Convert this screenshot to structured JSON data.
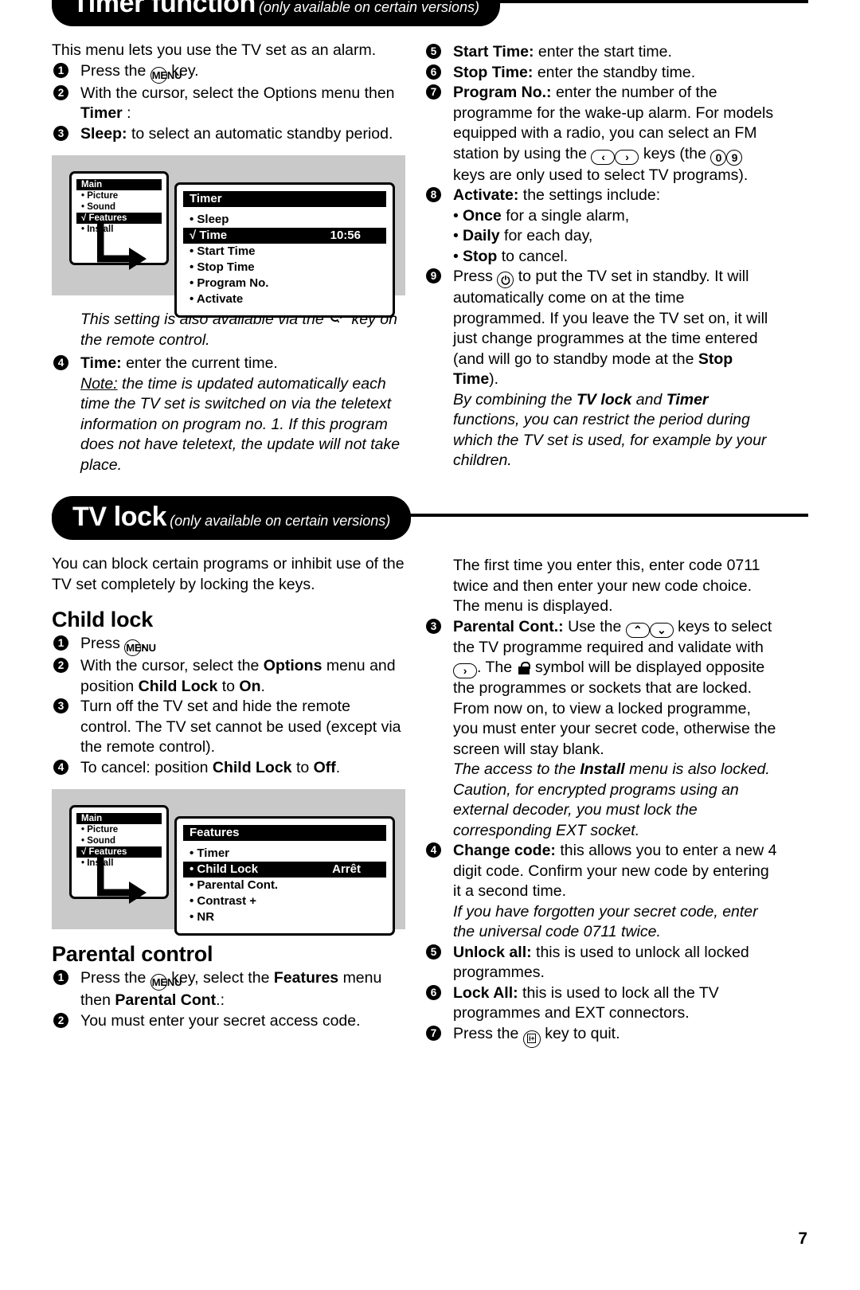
{
  "page": {
    "number": "7"
  },
  "sections": {
    "timer": {
      "banner_title": "Timer function",
      "banner_sub": "(only available on certain versions)",
      "intro": "This menu lets you use the TV set as an alarm.",
      "step1_pre": "Press the",
      "step1_post": "key.",
      "step2_line1": "With the cursor, select the Options menu then",
      "step2_line2_bold": "Timer",
      "step2_line2_post": ":",
      "step3_bold": "Sleep:",
      "step3_rest": "to select an automatic standby period.",
      "note_pre": "This setting is also available via the",
      "note_post": "key on the remote control.",
      "step4_bold": "Time:",
      "step4_rest": "enter the current time.",
      "step4_note_label": "Note:",
      "step4_note": "the time is updated automatically each time the TV set is switched on via the teletext information on program no. 1. If this program does not have teletext, the update will not take place.",
      "step5_bold": "Start Time:",
      "step5_rest": "enter the start time.",
      "step6_bold": "Stop Time:",
      "step6_rest": "enter the standby time.",
      "step7_bold": "Program No.:",
      "step7_rest_a": "enter the number of the programme for the wake-up alarm. For models equipped with a radio, you can select an FM station by using the",
      "step7_rest_b": "keys (the",
      "step7_rest_c": "keys are only used to select TV programs).",
      "step8_bold": "Activate:",
      "step8_rest": "the settings include:",
      "step8_b1_bold": "Once",
      "step8_b1_rest": "for a single alarm,",
      "step8_b2_bold": "Daily",
      "step8_b2_rest": "for each day,",
      "step8_b3_bold": "Stop",
      "step8_b3_rest": "to cancel.",
      "step9_pre": "Press",
      "step9_mid": "to put the TV set in standby. It will automatically come on at the time programmed. If you leave the TV set on, it will just change programmes at the time entered (and will go to standby mode at the",
      "step9_bold": "Stop Time",
      "step9_post": ").",
      "step9_note_a": "By combining the",
      "step9_note_b1": "TV lock",
      "step9_note_c": "and",
      "step9_note_b2": "Timer",
      "step9_note_d": "functions, you can restrict the period during which the TV set is used, for example by your children.",
      "menu": {
        "main_head": "Main",
        "main_items": [
          {
            "label": "• Picture",
            "selected": false
          },
          {
            "label": "• Sound",
            "selected": false
          },
          {
            "label": "√ Features",
            "selected": true
          },
          {
            "label": "• Install",
            "selected": false
          }
        ],
        "sub_head": "Timer",
        "sub_items": [
          {
            "label": "• Sleep",
            "value": "",
            "selected": false
          },
          {
            "label": "√ Time",
            "value": "10:56",
            "selected": true
          },
          {
            "label": "• Start Time",
            "value": "",
            "selected": false
          },
          {
            "label": "• Stop Time",
            "value": "",
            "selected": false
          },
          {
            "label": "• Program No.",
            "value": "",
            "selected": false
          },
          {
            "label": "• Activate",
            "value": "",
            "selected": false
          }
        ]
      }
    },
    "tvlock": {
      "banner_title": "TV lock",
      "banner_sub": "(only available on certain versions)",
      "intro": "You can block certain programs or inhibit use of the TV set completely by locking the keys.",
      "childlock_heading": "Child lock",
      "cl_step1_pre": "Press",
      "cl_step1_post": ".",
      "cl_step2_a": "With the cursor, select the",
      "cl_step2_b1": "Options",
      "cl_step2_c": "menu and position",
      "cl_step2_b2": "Child Lock",
      "cl_step2_d": "to",
      "cl_step2_b3": "On",
      "cl_step2_e": ".",
      "cl_step3": "Turn off the TV set and hide the remote control. The TV set cannot be used (except via the remote control).",
      "cl_step4_a": "To cancel: position",
      "cl_step4_b1": "Child Lock",
      "cl_step4_c": "to",
      "cl_step4_b2": "Off",
      "cl_step4_d": ".",
      "parental_heading": "Parental control",
      "pc_step1_a": "Press the",
      "pc_step1_b": "key, select the",
      "pc_step1_bold1": "Features",
      "pc_step1_c": "menu then",
      "pc_step1_bold2": "Parental Cont",
      "pc_step1_d": ".:",
      "pc_step2": "You must enter your secret access code.",
      "pc_intro": "The first time you enter this, enter code 0711 twice and then enter your new code choice. The menu is displayed.",
      "pc_step3_bold": "Parental Cont.:",
      "pc_step3_a": "Use the",
      "pc_step3_b": "keys to select the TV programme required and validate with",
      "pc_step3_c": ". The",
      "pc_step3_d": "symbol will be displayed opposite the programmes or sockets that are locked. From now on, to view a locked programme, you must enter your secret code, otherwise the screen will stay blank.",
      "pc_step3_note_a": "The access to the",
      "pc_step3_note_bold": "Install",
      "pc_step3_note_b": "menu is also locked. Caution, for encrypted programs using an external decoder, you must lock the corresponding EXT socket.",
      "pc_step4_bold": "Change code:",
      "pc_step4_rest": "this allows you to enter a new 4 digit code. Confirm your new code by entering it a second time.",
      "pc_step4_note": "If you have forgotten your secret code, enter the universal code 0711 twice.",
      "pc_step5_bold": "Unlock all:",
      "pc_step5_rest": "this is used to unlock all locked programmes.",
      "pc_step6_bold": "Lock All:",
      "pc_step6_rest": "this is used to lock all the TV programmes and EXT connectors.",
      "pc_step7_pre": "Press the",
      "pc_step7_post": "key to quit.",
      "menu": {
        "main_head": "Main",
        "main_items": [
          {
            "label": "• Picture",
            "selected": false
          },
          {
            "label": "• Sound",
            "selected": false
          },
          {
            "label": "√ Features",
            "selected": true
          },
          {
            "label": "• Install",
            "selected": false
          }
        ],
        "sub_head": "Features",
        "sub_items": [
          {
            "label": "• Timer",
            "value": "",
            "selected": false
          },
          {
            "label": "• Child Lock",
            "value": "Arrêt",
            "selected": true
          },
          {
            "label": "• Parental Cont.",
            "value": "",
            "selected": false
          },
          {
            "label": "• Contrast +",
            "value": "",
            "selected": false
          },
          {
            "label": "• NR",
            "value": "",
            "selected": false
          }
        ]
      }
    }
  },
  "keys": {
    "menu": "MENU",
    "left": "‹",
    "right": "›",
    "up": "⌃",
    "down": "⌄",
    "digit0": "0",
    "digit9": "9",
    "power": "⏻",
    "info": "i+"
  },
  "numbers": [
    "1",
    "2",
    "3",
    "4",
    "5",
    "6",
    "7",
    "8",
    "9"
  ]
}
